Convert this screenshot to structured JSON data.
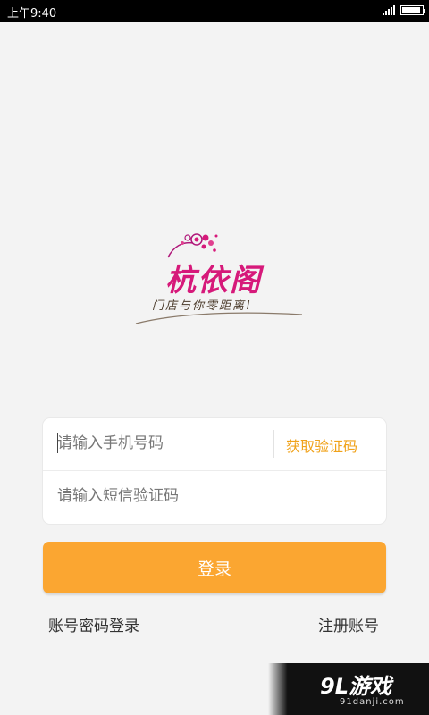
{
  "status_bar": {
    "time": "上午9:40",
    "battery_level": 0.9,
    "background": "#000000"
  },
  "logo": {
    "name": "杭依阁",
    "tagline": "门店与你零距离!",
    "brand_color": "#d6197a"
  },
  "form": {
    "phone_placeholder": "请输入手机号码",
    "get_code_label": "获取验证码",
    "code_placeholder": "请输入短信验证码",
    "accent_color": "#f0a21a"
  },
  "actions": {
    "login_label": "登录",
    "login_color": "#fba631",
    "password_login_label": "账号密码登录",
    "register_label": "注册账号"
  },
  "watermark": {
    "main": "9L游戏",
    "sub": "91danji.com"
  }
}
